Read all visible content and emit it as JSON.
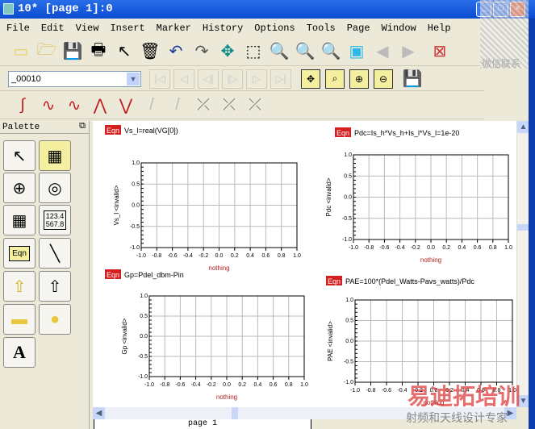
{
  "window": {
    "title": "10* [page 1]:0"
  },
  "menu": [
    "File",
    "Edit",
    "View",
    "Insert",
    "Marker",
    "History",
    "Options",
    "Tools",
    "Page",
    "Window",
    "Help"
  ],
  "toolbar2": {
    "combo_value": "_00010"
  },
  "palette": {
    "title": "Palette",
    "eqn_label": "Eqn",
    "table_label": "123.4 567.8",
    "text_label": "A"
  },
  "page_tab": "page 1",
  "eqn_badge": "Eqn",
  "watermark": {
    "qr_caption": "微信联系",
    "brand": "易迪拓培训",
    "slogan": "射频和天线设计专家"
  },
  "chart_data": [
    {
      "type": "line",
      "equation": "Vs_l=real(VG[0])",
      "ylabel": "Vs_l <invalid>",
      "xlabel": "nothing",
      "xlim": [
        -1,
        1
      ],
      "ylim": [
        -1,
        1
      ],
      "xticks": [
        "-1.0",
        "-0.8",
        "-0.6",
        "-0.4",
        "-0.2",
        "0.0",
        "0.2",
        "0.4",
        "0.6",
        "0.8",
        "1.0"
      ],
      "yticks": [
        "1.0",
        "0.5",
        "0.0",
        "-0.5",
        "-1.0"
      ],
      "series": []
    },
    {
      "type": "line",
      "equation": "Pdc=Is_h*Vs_h+Is_l*Vs_l=1e-20",
      "ylabel": "Pdc <invalid>",
      "xlabel": "nothing",
      "xlim": [
        -1,
        1
      ],
      "ylim": [
        -1,
        1
      ],
      "xticks": [
        "-1.0",
        "-0.8",
        "-0.6",
        "-0.4",
        "-0.2",
        "0.0",
        "0.2",
        "0.4",
        "0.6",
        "0.8",
        "1.0"
      ],
      "yticks": [
        "1.0",
        "0.5",
        "0.0",
        "-0.5",
        "-1.0"
      ],
      "series": []
    },
    {
      "type": "line",
      "equation": "Gp=Pdel_dbm-Pin",
      "ylabel": "Gp <invalid>",
      "xlabel": "nothing",
      "xlim": [
        -1,
        1
      ],
      "ylim": [
        -1,
        1
      ],
      "xticks": [
        "-1.0",
        "-0.8",
        "-0.6",
        "-0.4",
        "-0.2",
        "0.0",
        "0.2",
        "0.4",
        "0.6",
        "0.8",
        "1.0"
      ],
      "yticks": [
        "1.0",
        "0.5",
        "0.0",
        "-0.5",
        "-1.0"
      ],
      "series": []
    },
    {
      "type": "line",
      "equation": "PAE=100*(Pdel_Watts-Pavs_watts)/Pdc",
      "ylabel": "PAE <invalid>",
      "xlabel": "nothing",
      "xlim": [
        -1,
        1
      ],
      "ylim": [
        -1,
        1
      ],
      "xticks": [
        "-1.0",
        "-0.8",
        "-0.6",
        "-0.4",
        "-0.2",
        "0.0",
        "0.2",
        "0.4",
        "0.6",
        "0.8",
        "1.0"
      ],
      "yticks": [
        "1.0",
        "0.5",
        "0.0",
        "-0.5",
        "-1.0"
      ],
      "series": []
    }
  ]
}
